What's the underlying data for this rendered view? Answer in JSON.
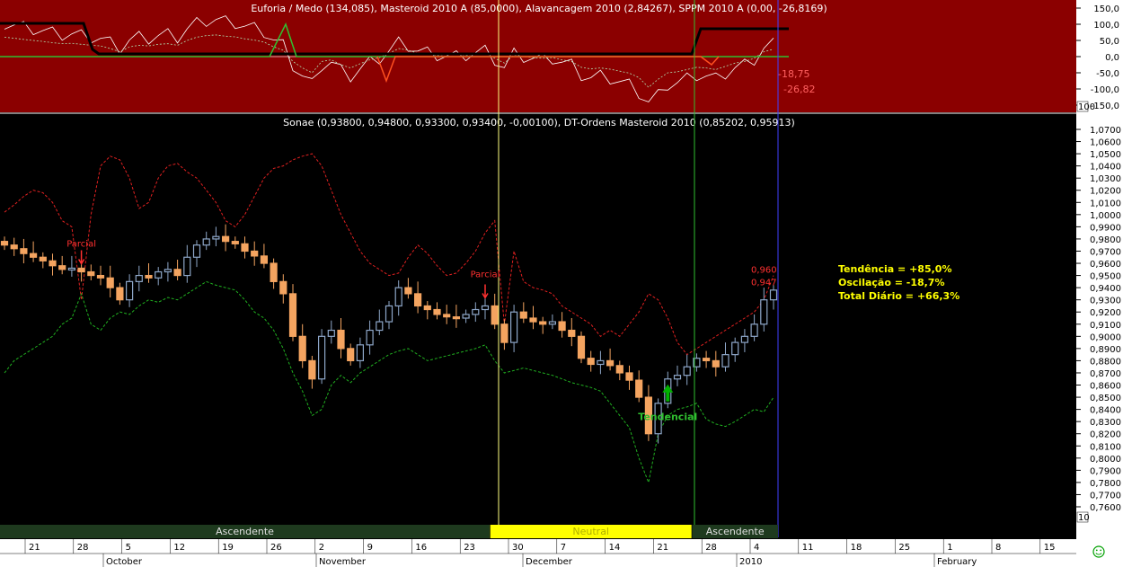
{
  "chart_data": [
    {
      "type": "line",
      "title": "Euforia / Medo (134,085), Masteroid 2010 A (85,0000), Alavancagem 2010 (2,84267), SPPM 2010 A (0,00, -26,8169)",
      "yticks": [
        "150,0",
        "100,0",
        "50,0",
        "0,0",
        "-50,0",
        "-100,0",
        "-150,0"
      ],
      "ylim": [
        -150,
        150
      ],
      "axis_box_label": "100",
      "value_labels": [
        "-18,75",
        "-26,82"
      ]
    },
    {
      "type": "candlestick",
      "title": "Sonae (0,93800, 0,94800, 0,93300, 0,93400, -0,00100), DT-Ordens Masteroid 2010 (0,85202, 0,95913)",
      "yticks": [
        "1,0700",
        "1,0600",
        "1,0500",
        "1,0400",
        "1,0300",
        "1,0200",
        "1,0100",
        "1,0000",
        "0,9900",
        "0,9800",
        "0,9700",
        "0,9600",
        "0,9500",
        "0,9400",
        "0,9300",
        "0,9200",
        "0,9100",
        "0,9000",
        "0,8900",
        "0,8800",
        "0,8700",
        "0,8600",
        "0,8500",
        "0,8400",
        "0,8300",
        "0,8200",
        "0,8100",
        "0,8000",
        "0,7900",
        "0,7800",
        "0,7700",
        "0,7600"
      ],
      "ylim": [
        0.755,
        1.075
      ],
      "axis_box_label": "10",
      "close": [
        0.975,
        0.972,
        0.968,
        0.965,
        0.962,
        0.958,
        0.955,
        0.956,
        0.953,
        0.95,
        0.948,
        0.94,
        0.93,
        0.945,
        0.95,
        0.948,
        0.953,
        0.955,
        0.95,
        0.965,
        0.975,
        0.98,
        0.982,
        0.978,
        0.976,
        0.97,
        0.966,
        0.96,
        0.945,
        0.935,
        0.9,
        0.88,
        0.865,
        0.9,
        0.905,
        0.89,
        0.88,
        0.893,
        0.905,
        0.912,
        0.925,
        0.94,
        0.935,
        0.925,
        0.922,
        0.918,
        0.916,
        0.915,
        0.918,
        0.922,
        0.925,
        0.91,
        0.895,
        0.92,
        0.915,
        0.912,
        0.91,
        0.912,
        0.905,
        0.9,
        0.882,
        0.877,
        0.88,
        0.876,
        0.87,
        0.864,
        0.85,
        0.82,
        0.845,
        0.865,
        0.868,
        0.875,
        0.882,
        0.88,
        0.875,
        0.885,
        0.895,
        0.9,
        0.91,
        0.93,
        0.938
      ],
      "upper_band": [
        1.002,
        1.008,
        1.015,
        1.02,
        1.018,
        1.01,
        0.995,
        0.99,
        0.93,
        1.0,
        1.04,
        1.048,
        1.045,
        1.03,
        1.005,
        1.01,
        1.03,
        1.04,
        1.042,
        1.035,
        1.03,
        1.02,
        1.01,
        0.995,
        0.99,
        1.0,
        1.015,
        1.03,
        1.038,
        1.04,
        1.045,
        1.048,
        1.05,
        1.04,
        1.02,
        1.0,
        0.985,
        0.97,
        0.96,
        0.955,
        0.95,
        0.952,
        0.965,
        0.975,
        0.968,
        0.958,
        0.95,
        0.952,
        0.96,
        0.97,
        0.985,
        0.995,
        0.91,
        0.97,
        0.945,
        0.94,
        0.938,
        0.935,
        0.925,
        0.92,
        0.915,
        0.91,
        0.9,
        0.905,
        0.9,
        0.91,
        0.92,
        0.935,
        0.93,
        0.915,
        0.895,
        0.885,
        0.89,
        0.895,
        0.9,
        0.905,
        0.91,
        0.915,
        0.92,
        0.93,
        0.95
      ],
      "lower_band": [
        0.87,
        0.88,
        0.885,
        0.89,
        0.895,
        0.9,
        0.91,
        0.915,
        0.935,
        0.91,
        0.905,
        0.915,
        0.92,
        0.918,
        0.925,
        0.93,
        0.928,
        0.932,
        0.93,
        0.935,
        0.94,
        0.945,
        0.942,
        0.94,
        0.938,
        0.93,
        0.92,
        0.915,
        0.905,
        0.89,
        0.87,
        0.855,
        0.835,
        0.84,
        0.86,
        0.868,
        0.862,
        0.87,
        0.875,
        0.88,
        0.885,
        0.888,
        0.89,
        0.885,
        0.88,
        0.882,
        0.884,
        0.886,
        0.888,
        0.89,
        0.893,
        0.88,
        0.87,
        0.872,
        0.874,
        0.872,
        0.87,
        0.868,
        0.865,
        0.862,
        0.86,
        0.858,
        0.855,
        0.845,
        0.835,
        0.825,
        0.8,
        0.78,
        0.82,
        0.835,
        0.84,
        0.842,
        0.845,
        0.832,
        0.828,
        0.826,
        0.83,
        0.835,
        0.84,
        0.838,
        0.85
      ],
      "annotations": [
        {
          "text": "Parcial",
          "x_index": 8
        },
        {
          "text": "Parcial",
          "x_index": 50
        },
        {
          "text": "Tendencial",
          "x_index": 69
        },
        {
          "text": "0,960",
          "x_index": 79
        },
        {
          "text": "0,947",
          "x_index": 79
        }
      ],
      "stats": [
        "Tendência = +85,0%",
        "Oscilação = -18,7%",
        "Total Diário = +66,3%"
      ],
      "regimes": [
        {
          "label": "Ascendente",
          "start": 0,
          "end": 50
        },
        {
          "label": "Neutral",
          "start": 51,
          "end": 71
        },
        {
          "label": "Ascendente",
          "start": 72,
          "end": 80
        }
      ]
    }
  ],
  "x_axis": {
    "day_labels": [
      "21",
      "28",
      "5",
      "12",
      "19",
      "26",
      "2",
      "9",
      "16",
      "23",
      "30",
      "7",
      "14",
      "21",
      "28",
      "4",
      "11",
      "18",
      "25",
      "1",
      "8",
      "15"
    ],
    "month_labels": [
      "October",
      "November",
      "December",
      "2010",
      "February"
    ]
  },
  "colors": {
    "top_panel_bg": "#8b0000",
    "up_candle": "#8ea7c9",
    "down_candle": "#f4a460",
    "upper_band": "#e02020",
    "lower_band": "#20b020",
    "neutral_band": "#ffff00",
    "stats_text": "#ffff00"
  }
}
